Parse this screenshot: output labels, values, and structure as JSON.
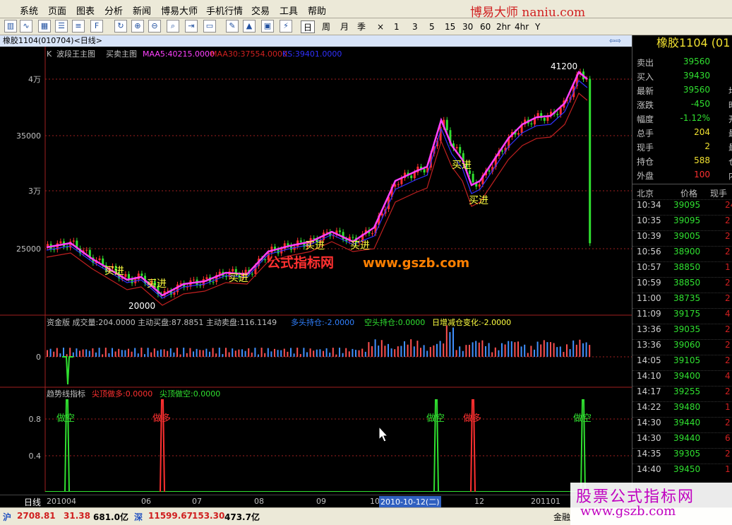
{
  "menu": [
    "系统",
    "页面",
    "图表",
    "分析",
    "新闻",
    "博易大师",
    "手机行情",
    "交易",
    "工具",
    "帮助"
  ],
  "brand": "博易大师  naniu.com",
  "periods": [
    "日",
    "周",
    "月",
    "季",
    "×",
    "1",
    "3",
    "5",
    "15",
    "30",
    "60",
    "2hr",
    "4hr",
    "Y"
  ],
  "active_period": "日",
  "window_title": "橡胶1104(010704)<日线>",
  "main_legend": {
    "k": "K",
    "name1": "波段王主图",
    "name2": "买卖主图",
    "maa5": "MAA5:40215.0000",
    "maa30": "MAA30:37554.0000",
    "ks": "KS:39401.0000"
  },
  "price_axis": [
    "4万",
    "35000",
    "3万",
    "25000"
  ],
  "annotations": {
    "high": "41200",
    "low": "20000",
    "buy": "买进",
    "watermark": "公式指标网",
    "watermark_url": "www.gszb.com"
  },
  "volume_legend": "资金版 成交量:204.0000  主动买盘:87.8851  主动卖盘:116.1149",
  "volume_legend_long": "多头持仓:-2.0000",
  "volume_legend_short": "空头持仓:0.0000",
  "volume_legend_change": "日增减仓变化:-2.0000",
  "volume_axis": [
    "0"
  ],
  "trend_legend": "趋势线指标",
  "trend_legend_top_long": "尖顶做多:0.0000",
  "trend_legend_top_short": "尖顶做空:0.0000",
  "trend_axis": [
    "0.8",
    "0.4"
  ],
  "signal_short": "做空",
  "signal_long": "做多",
  "date_axis": {
    "label": "日线",
    "ticks": [
      "201004",
      "06",
      "07",
      "08",
      "09",
      "10",
      "12",
      "201101"
    ],
    "cursor": "2010-10-12(二)"
  },
  "status": {
    "sh_label": "沪",
    "sh_index": "2708.81",
    "sh_change": "31.38",
    "sh_amount": "681.0亿",
    "sz_label": "深",
    "sz_index": "11599.67",
    "sz_change": "153.30",
    "sz_amount": "473.7亿",
    "right_text": "金融"
  },
  "quote": {
    "title": "橡胶1104 (01",
    "rows": [
      {
        "k": "卖出",
        "v": "39560",
        "x": ""
      },
      {
        "k": "买入",
        "v": "39430",
        "x": ""
      },
      {
        "k": "最新",
        "v": "39560",
        "x": "均"
      },
      {
        "k": "涨跌",
        "v": "-450",
        "x": "昨"
      },
      {
        "k": "幅度",
        "v": "-1.12%",
        "x": "开"
      },
      {
        "k": "总手",
        "v": "204",
        "x": "最"
      },
      {
        "k": "现手",
        "v": "2",
        "x": "最"
      },
      {
        "k": "持仓",
        "v": "588",
        "x": "仓"
      },
      {
        "k": "外盘",
        "v": "100",
        "x": "内"
      }
    ],
    "ticks_header": [
      "北京",
      "价格",
      "现手"
    ],
    "ticks": [
      {
        "t": "10:34",
        "p": "39095",
        "n": "24"
      },
      {
        "t": "10:35",
        "p": "39095",
        "n": "2"
      },
      {
        "t": "10:39",
        "p": "39005",
        "n": "2"
      },
      {
        "t": "10:56",
        "p": "38900",
        "n": "2"
      },
      {
        "t": "10:57",
        "p": "38850",
        "n": "1"
      },
      {
        "t": "10:59",
        "p": "38850",
        "n": "2"
      },
      {
        "t": "11:00",
        "p": "38735",
        "n": "2"
      },
      {
        "t": "11:09",
        "p": "39175",
        "n": "4"
      },
      {
        "t": "13:36",
        "p": "39035",
        "n": "2"
      },
      {
        "t": "13:36",
        "p": "39060",
        "n": "2"
      },
      {
        "t": "14:05",
        "p": "39105",
        "n": "2"
      },
      {
        "t": "14:10",
        "p": "39400",
        "n": "4"
      },
      {
        "t": "14:17",
        "p": "39255",
        "n": "2"
      },
      {
        "t": "14:22",
        "p": "39480",
        "n": "1"
      },
      {
        "t": "14:30",
        "p": "39440",
        "n": "2"
      },
      {
        "t": "14:30",
        "p": "39440",
        "n": "6"
      },
      {
        "t": "14:35",
        "p": "39305",
        "n": "2"
      },
      {
        "t": "14:40",
        "p": "39450",
        "n": "1"
      }
    ]
  },
  "promo": {
    "line1": "股票公式指标网",
    "line2": "www.gszb.com"
  },
  "colors": {
    "up": "#ff3030",
    "down": "#30e030",
    "ma5": "#ff40ff",
    "ma30": "#c02020",
    "ks": "#3030ff"
  }
}
